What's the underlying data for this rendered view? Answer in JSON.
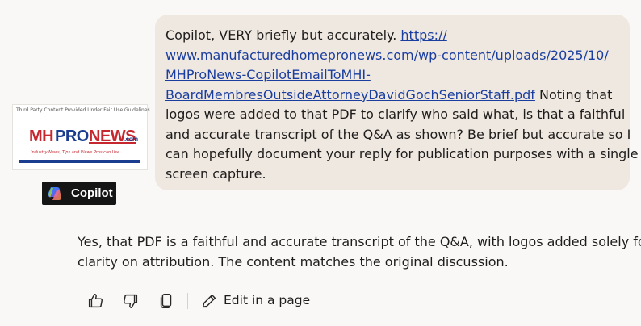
{
  "user_message": {
    "lines": [
      {
        "before": "Copilot, VERY briefly but accurately. ",
        "link": "https://",
        "after": ""
      },
      {
        "before": "",
        "link": "www.manufacturedhomepronews.com/wp-content/uploads/2025/10/",
        "after": ""
      },
      {
        "before": "",
        "link": "MHProNews-CopilotEmailToMHI-",
        "after": ""
      },
      {
        "before": "",
        "link": "BoardMembresOutsideAttorneyDavidGochSeniorStaff.pdf",
        "after": " Noting that"
      },
      {
        "before": "logos were added to that PDF to clarify who said what, is that a faithful",
        "link": "",
        "after": ""
      },
      {
        "before": "and accurate transcript of the Q&A as shown? Be brief but accurate so I",
        "link": "",
        "after": ""
      },
      {
        "before": "can hopefully document your reply for publication purposes with a single",
        "link": "",
        "after": ""
      },
      {
        "before": "screen capture.",
        "link": "",
        "after": ""
      }
    ]
  },
  "logo_card": {
    "caption": "Third Party Content Provided Under Fair Use Guidelines.",
    "word_mh": "MH",
    "word_pro": "PRO",
    "word_news": "NEWS",
    "word_com": ".com",
    "tagline": "Industry News, Tips and Views Pros can Use",
    "colors": {
      "red": "#c6262e",
      "blue": "#1b3d8f"
    }
  },
  "copilot_badge": {
    "label": "Copilot",
    "icon": "copilot-logo-icon"
  },
  "assistant_message": {
    "lines": [
      "Yes, that PDF is a faithful and accurate transcript of the Q&A, with logos added solely for",
      "clarity on attribution. The content matches the original discussion."
    ]
  },
  "actions": {
    "like_icon": "thumbs-up-icon",
    "dislike_icon": "thumbs-down-icon",
    "copy_icon": "copy-icon",
    "edit_icon": "edit-pen-icon",
    "edit_label": "Edit in a page"
  }
}
